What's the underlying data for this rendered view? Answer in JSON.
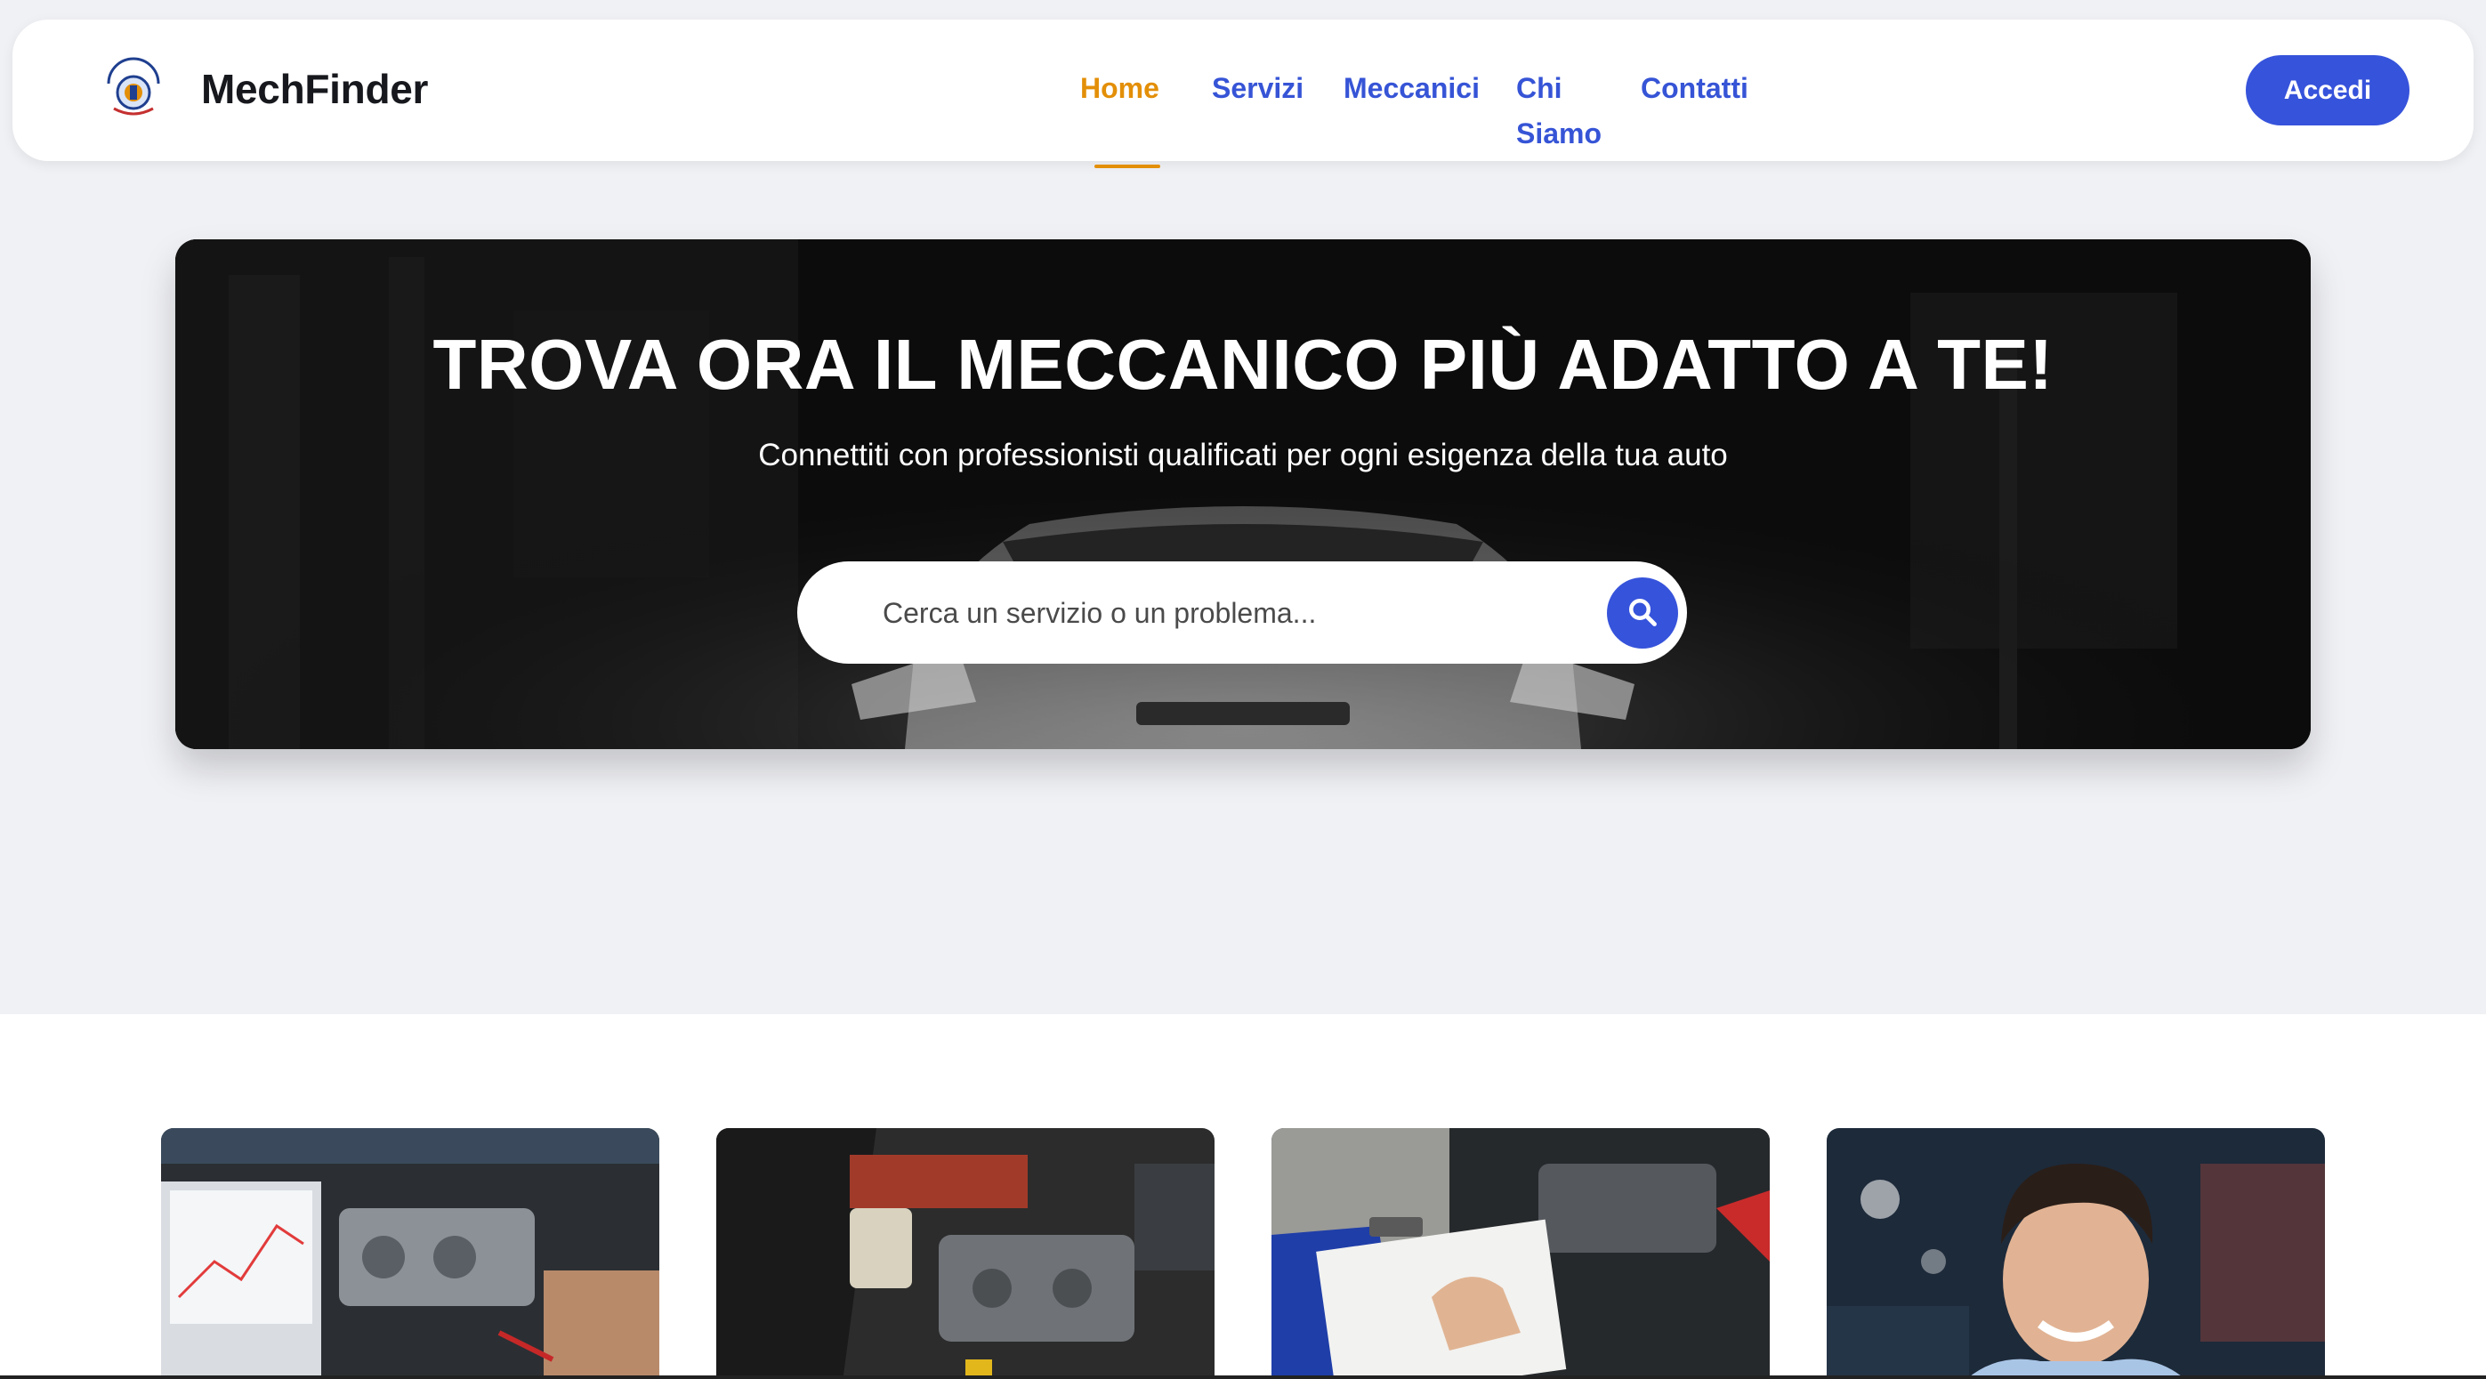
{
  "header": {
    "brand": "MechFinder",
    "logo_icon": "mechfinder-logo-icon",
    "nav": [
      {
        "label": "Home",
        "active": true
      },
      {
        "label": "Servizi",
        "active": false
      },
      {
        "label": "Meccanici",
        "active": false
      },
      {
        "label": "Chi Siamo",
        "active": false
      },
      {
        "label": "Contatti",
        "active": false
      }
    ],
    "login_label": "Accedi"
  },
  "hero": {
    "title": "TROVA ORA IL MECCANICO PIÙ ADATTO A TE!",
    "subtitle": "Connettiti con professionisti qualificati per ogni esigenza della tua auto",
    "search": {
      "placeholder": "Cerca un servizio o un problema...",
      "value": "",
      "button_icon": "search-icon"
    }
  },
  "colors": {
    "primary": "#3653db",
    "accent": "#e38f08",
    "background": "#f0f1f5",
    "text_dark": "#16181d"
  }
}
